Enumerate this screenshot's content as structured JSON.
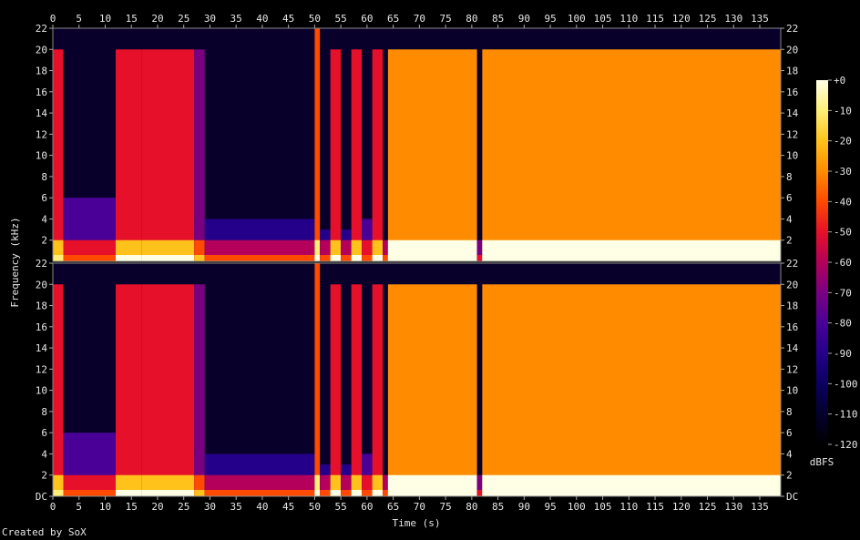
{
  "chart_data": {
    "type": "heatmap",
    "title": "",
    "xlabel": "Time (s)",
    "ylabel": "Frequency (kHz)",
    "xlim": [
      0,
      139
    ],
    "ylim": [
      0,
      22
    ],
    "x_ticks": [
      0,
      5,
      10,
      15,
      20,
      25,
      30,
      35,
      40,
      45,
      50,
      55,
      60,
      65,
      70,
      75,
      80,
      85,
      90,
      95,
      100,
      105,
      110,
      115,
      120,
      125,
      130,
      135
    ],
    "y_ticks": [
      "DC",
      "2",
      "4",
      "6",
      "8",
      "10",
      "12",
      "14",
      "16",
      "18",
      "20",
      "22"
    ],
    "channels": [
      "upper",
      "lower"
    ],
    "colorbar": {
      "label": "dBFS",
      "range": [
        -120,
        0
      ],
      "ticks": [
        "+0",
        "-10",
        "-20",
        "-30",
        "-40",
        "-50",
        "-60",
        "-70",
        "-80",
        "-90",
        "-100",
        "-110",
        "-120"
      ],
      "colors": [
        "#ffffe6",
        "#ffee77",
        "#ffc21a",
        "#ff8c00",
        "#ff4a00",
        "#e6102a",
        "#b4005a",
        "#7a0082",
        "#4a0096",
        "#24008a",
        "#0c0060",
        "#04002c",
        "#000000"
      ]
    },
    "segments": [
      {
        "t0": 0,
        "t1": 2,
        "level": 0.55,
        "fmax": 20
      },
      {
        "t0": 2,
        "t1": 12,
        "level": 0.3,
        "fmax": 6
      },
      {
        "t0": 12,
        "t1": 17,
        "level": 0.62,
        "fmax": 20
      },
      {
        "t0": 17,
        "t1": 27,
        "level": 0.58,
        "fmax": 20
      },
      {
        "t0": 27,
        "t1": 29,
        "level": 0.45,
        "fmax": 20
      },
      {
        "t0": 29,
        "t1": 50,
        "level": 0.28,
        "fmax": 4
      },
      {
        "t0": 50,
        "t1": 51,
        "level": 0.7,
        "fmax": 22
      },
      {
        "t0": 51,
        "t1": 53,
        "level": 0.25,
        "fmax": 3
      },
      {
        "t0": 53,
        "t1": 55,
        "level": 0.6,
        "fmax": 20
      },
      {
        "t0": 55,
        "t1": 57,
        "level": 0.25,
        "fmax": 3
      },
      {
        "t0": 57,
        "t1": 59,
        "level": 0.6,
        "fmax": 20
      },
      {
        "t0": 59,
        "t1": 61,
        "level": 0.3,
        "fmax": 4
      },
      {
        "t0": 61,
        "t1": 63,
        "level": 0.62,
        "fmax": 20
      },
      {
        "t0": 63,
        "t1": 64,
        "level": 0.25,
        "fmax": 2
      },
      {
        "t0": 64,
        "t1": 81,
        "level": 0.78,
        "fmax": 20
      },
      {
        "t0": 81,
        "t1": 82,
        "level": 0.2,
        "fmax": 2
      },
      {
        "t0": 82,
        "t1": 139,
        "level": 0.72,
        "fmax": 20
      }
    ],
    "colorbar_label_values": {
      "top": "+0",
      "bottom": "-120"
    }
  },
  "footer": {
    "credit": "Created by SoX"
  }
}
